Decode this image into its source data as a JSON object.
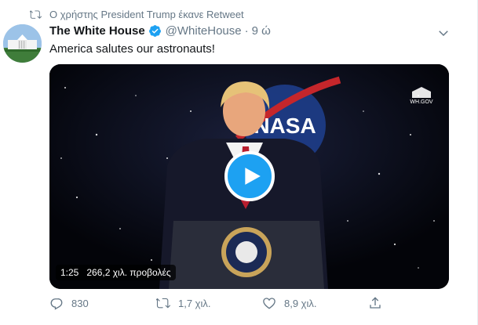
{
  "retweet": {
    "text": "Ο χρήστης President Trump έκανε Retweet"
  },
  "tweet": {
    "name": "The White House",
    "handle": "@WhiteHouse",
    "separator": "·",
    "time": "9 ώ",
    "text": "America salutes our astronauts!"
  },
  "video": {
    "duration": "1:25",
    "views": "266,2 χιλ. προβολές",
    "corner_logo_text": "WH.GOV",
    "backdrop_text": "NASA"
  },
  "actions": {
    "replies": "830",
    "retweets": "1,7 χιλ.",
    "likes": "8,9 χιλ."
  },
  "colors": {
    "accent": "#1da1f2",
    "muted": "#657786",
    "text": "#14171a"
  },
  "icons": [
    "retweet-icon",
    "verified-badge-icon",
    "chevron-down-icon",
    "play-icon",
    "reply-icon",
    "like-icon",
    "share-icon"
  ]
}
